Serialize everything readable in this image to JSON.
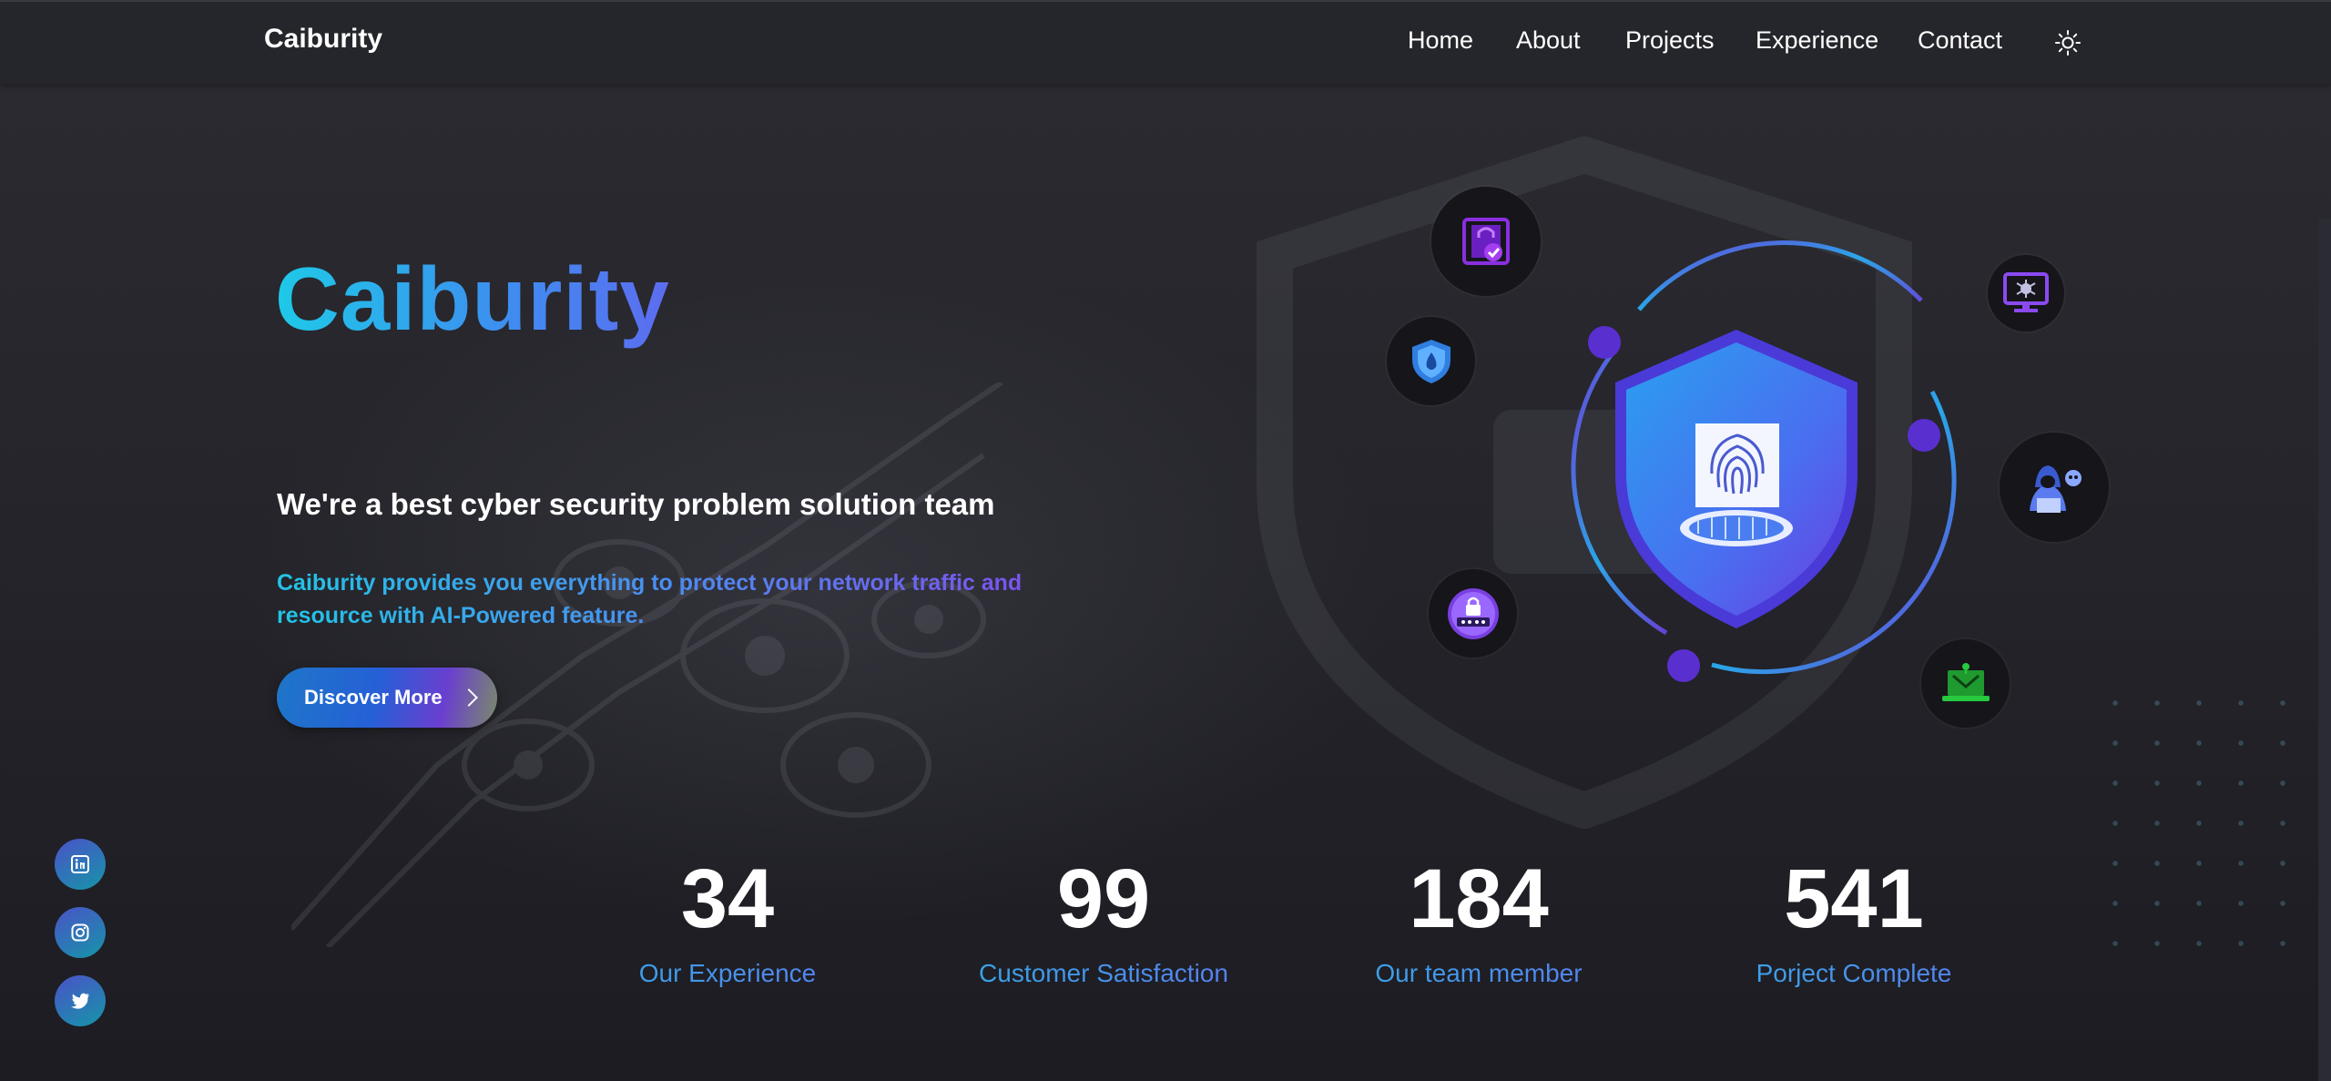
{
  "navbar": {
    "brand": "Caiburity",
    "links": [
      "Home",
      "About",
      "Projects",
      "Experience",
      "Contact"
    ],
    "theme_toggle_icon": "sun-icon"
  },
  "hero": {
    "title": "Caiburity",
    "tagline": "We're a best cyber security problem solution team",
    "description": "Caiburity provides you everything to protect your network traffic and resource with AI-Powered feature.",
    "cta_label": "Discover More",
    "cta_icon": "chevron-right-icon"
  },
  "illustration": {
    "center_icon": "fingerprint-shield-icon",
    "bubbles": [
      "lock-check-icon",
      "water-shield-icon",
      "bug-monitor-icon",
      "hacker-icon",
      "password-lock-icon",
      "virus-laptop-icon"
    ]
  },
  "stats": [
    {
      "value": "34",
      "label": "Our Experience"
    },
    {
      "value": "99",
      "label": "Customer Satisfaction"
    },
    {
      "value": "184",
      "label": "Our team member"
    },
    {
      "value": "541",
      "label": "Porject Complete"
    }
  ],
  "socials": [
    "linkedin-icon",
    "instagram-icon",
    "twitter-icon"
  ],
  "colors": {
    "background": "#1f1f24",
    "navbar": "#25262b",
    "accent_cyan": "#1ec9e8",
    "accent_blue": "#3f8cf0",
    "accent_purple": "#7b52ee",
    "icon_green": "#27c93f"
  }
}
